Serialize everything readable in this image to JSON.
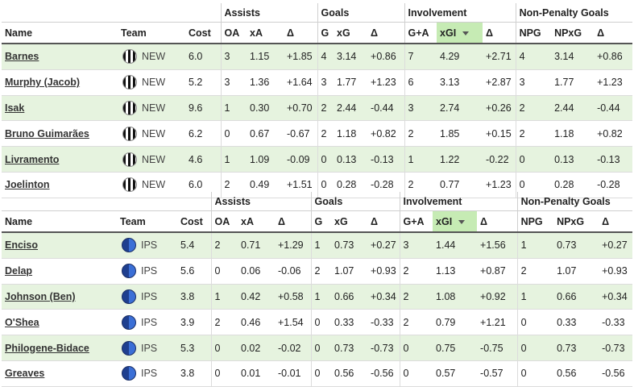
{
  "group_headers": {
    "assists": "Assists",
    "goals": "Goals",
    "involvement": "Involvement",
    "npg": "Non-Penalty Goals"
  },
  "columns": {
    "name": "Name",
    "team": "Team",
    "cost": "Cost",
    "oa": "OA",
    "xa": "xA",
    "delta": "Δ",
    "g": "G",
    "xg": "xG",
    "ga": "G+A",
    "xgi": "xGI",
    "npg": "NPG",
    "npxg": "NPxG"
  },
  "tables": [
    {
      "team_icon": "crest-new-icon",
      "rows": [
        {
          "name": "Barnes",
          "team": "NEW",
          "cost": "6.0",
          "oa": "3",
          "xa": "1.15",
          "da": "+1.85",
          "g": "4",
          "xg": "3.14",
          "dg": "+0.86",
          "ga": "7",
          "xgi": "4.29",
          "di": "+2.71",
          "npg": "4",
          "npxg": "3.14",
          "dn": "+0.86"
        },
        {
          "name": "Murphy (Jacob)",
          "team": "NEW",
          "cost": "5.2",
          "oa": "3",
          "xa": "1.36",
          "da": "+1.64",
          "g": "3",
          "xg": "1.77",
          "dg": "+1.23",
          "ga": "6",
          "xgi": "3.13",
          "di": "+2.87",
          "npg": "3",
          "npxg": "1.77",
          "dn": "+1.23"
        },
        {
          "name": "Isak",
          "team": "NEW",
          "cost": "9.6",
          "oa": "1",
          "xa": "0.30",
          "da": "+0.70",
          "g": "2",
          "xg": "2.44",
          "dg": "-0.44",
          "ga": "3",
          "xgi": "2.74",
          "di": "+0.26",
          "npg": "2",
          "npxg": "2.44",
          "dn": "-0.44"
        },
        {
          "name": "Bruno Guimarães",
          "team": "NEW",
          "cost": "6.2",
          "oa": "0",
          "xa": "0.67",
          "da": "-0.67",
          "g": "2",
          "xg": "1.18",
          "dg": "+0.82",
          "ga": "2",
          "xgi": "1.85",
          "di": "+0.15",
          "npg": "2",
          "npxg": "1.18",
          "dn": "+0.82"
        },
        {
          "name": "Livramento",
          "team": "NEW",
          "cost": "4.6",
          "oa": "1",
          "xa": "1.09",
          "da": "-0.09",
          "g": "0",
          "xg": "0.13",
          "dg": "-0.13",
          "ga": "1",
          "xgi": "1.22",
          "di": "-0.22",
          "npg": "0",
          "npxg": "0.13",
          "dn": "-0.13"
        },
        {
          "name": "Joelinton",
          "team": "NEW",
          "cost": "6.0",
          "oa": "2",
          "xa": "0.49",
          "da": "+1.51",
          "g": "0",
          "xg": "0.28",
          "dg": "-0.28",
          "ga": "2",
          "xgi": "0.77",
          "di": "+1.23",
          "npg": "0",
          "npxg": "0.28",
          "dn": "-0.28"
        }
      ]
    },
    {
      "team_icon": "crest-ips-icon",
      "rows": [
        {
          "name": "Enciso",
          "team": "IPS",
          "cost": "5.4",
          "oa": "2",
          "xa": "0.71",
          "da": "+1.29",
          "g": "1",
          "xg": "0.73",
          "dg": "+0.27",
          "ga": "3",
          "xgi": "1.44",
          "di": "+1.56",
          "npg": "1",
          "npxg": "0.73",
          "dn": "+0.27"
        },
        {
          "name": "Delap",
          "team": "IPS",
          "cost": "5.6",
          "oa": "0",
          "xa": "0.06",
          "da": "-0.06",
          "g": "2",
          "xg": "1.07",
          "dg": "+0.93",
          "ga": "2",
          "xgi": "1.13",
          "di": "+0.87",
          "npg": "2",
          "npxg": "1.07",
          "dn": "+0.93"
        },
        {
          "name": "Johnson (Ben)",
          "team": "IPS",
          "cost": "3.8",
          "oa": "1",
          "xa": "0.42",
          "da": "+0.58",
          "g": "1",
          "xg": "0.66",
          "dg": "+0.34",
          "ga": "2",
          "xgi": "1.08",
          "di": "+0.92",
          "npg": "1",
          "npxg": "0.66",
          "dn": "+0.34"
        },
        {
          "name": "O'Shea",
          "team": "IPS",
          "cost": "3.9",
          "oa": "2",
          "xa": "0.46",
          "da": "+1.54",
          "g": "0",
          "xg": "0.33",
          "dg": "-0.33",
          "ga": "2",
          "xgi": "0.79",
          "di": "+1.21",
          "npg": "0",
          "npxg": "0.33",
          "dn": "-0.33"
        },
        {
          "name": "Philogene-Bidace",
          "team": "IPS",
          "cost": "5.3",
          "oa": "0",
          "xa": "0.02",
          "da": "-0.02",
          "g": "0",
          "xg": "0.73",
          "dg": "-0.73",
          "ga": "0",
          "xgi": "0.75",
          "di": "-0.75",
          "npg": "0",
          "npxg": "0.73",
          "dn": "-0.73"
        },
        {
          "name": "Greaves",
          "team": "IPS",
          "cost": "3.8",
          "oa": "0",
          "xa": "0.01",
          "da": "-0.01",
          "g": "0",
          "xg": "0.56",
          "dg": "-0.56",
          "ga": "0",
          "xgi": "0.57",
          "di": "-0.57",
          "npg": "0",
          "npxg": "0.56",
          "dn": "-0.56"
        }
      ]
    }
  ]
}
